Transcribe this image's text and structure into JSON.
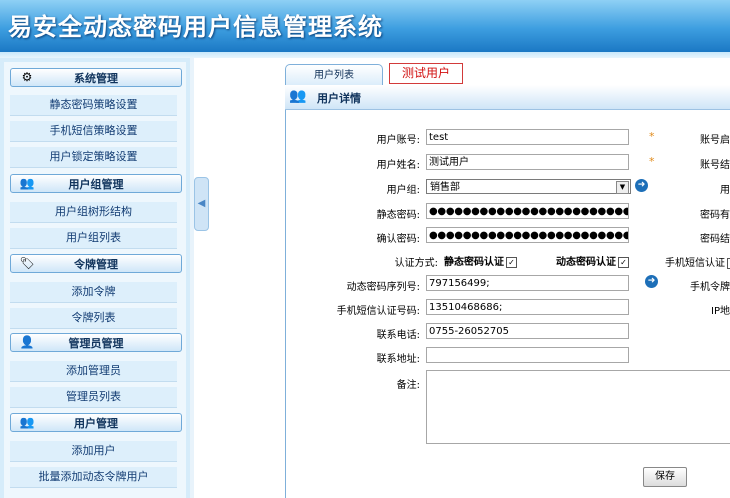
{
  "app_title": "易安全动态密码用户信息管理系统",
  "sidebar": {
    "sections": [
      {
        "title": "系统管理",
        "icon": "settings-icon",
        "items": [
          "静态密码策略设置",
          "手机短信策略设置",
          "用户锁定策略设置"
        ]
      },
      {
        "title": "用户组管理",
        "icon": "group-icon",
        "items": [
          "用户组树形结构",
          "用户组列表"
        ]
      },
      {
        "title": "令牌管理",
        "icon": "token-icon",
        "items": [
          "添加令牌",
          "令牌列表"
        ]
      },
      {
        "title": "管理员管理",
        "icon": "admin-icon",
        "items": [
          "添加管理员",
          "管理员列表"
        ]
      },
      {
        "title": "用户管理",
        "icon": "users-icon",
        "items": [
          "添加用户",
          "批量添加动态令牌用户"
        ]
      }
    ]
  },
  "tabs": {
    "active": "用户列表",
    "current_user": "测试用户"
  },
  "panel": {
    "title": "用户详情"
  },
  "form": {
    "account_label": "用户账号:",
    "account_value": "test",
    "name_label": "用户姓名:",
    "name_value": "测试用户",
    "group_label": "用户组:",
    "group_value": "销售部",
    "static_pwd_label": "静态密码:",
    "static_pwd_value": "●●●●●●●●●●●●●●●●●●●●●●●●●●●●●●",
    "confirm_pwd_label": "确认密码:",
    "confirm_pwd_value": "●●●●●●●●●●●●●●●●●●●●●●●●●●●●●●",
    "auth_label": "认证方式:",
    "auth_static": "静态密码认证",
    "auth_dynamic": "动态密码认证",
    "token_sn_label": "动态密码序列号:",
    "token_sn_value": "797156499;",
    "sms_label": "手机短信认证号码:",
    "sms_value": "13510468686;",
    "phone_label": "联系电话:",
    "phone_value": "0755-26052705",
    "address_label": "联系地址:",
    "address_value": "",
    "remark_label": "备注:",
    "required_mark": "*",
    "save_label": "保存"
  },
  "right_column": {
    "account_enable": "账号启",
    "account_end": "账号结",
    "user_truncated": "用",
    "pwd_valid": "密码有",
    "pwd_end": "密码结",
    "sms_auth": "手机短信认证",
    "phone_token": "手机令牌",
    "ip_addr": "IP地"
  }
}
